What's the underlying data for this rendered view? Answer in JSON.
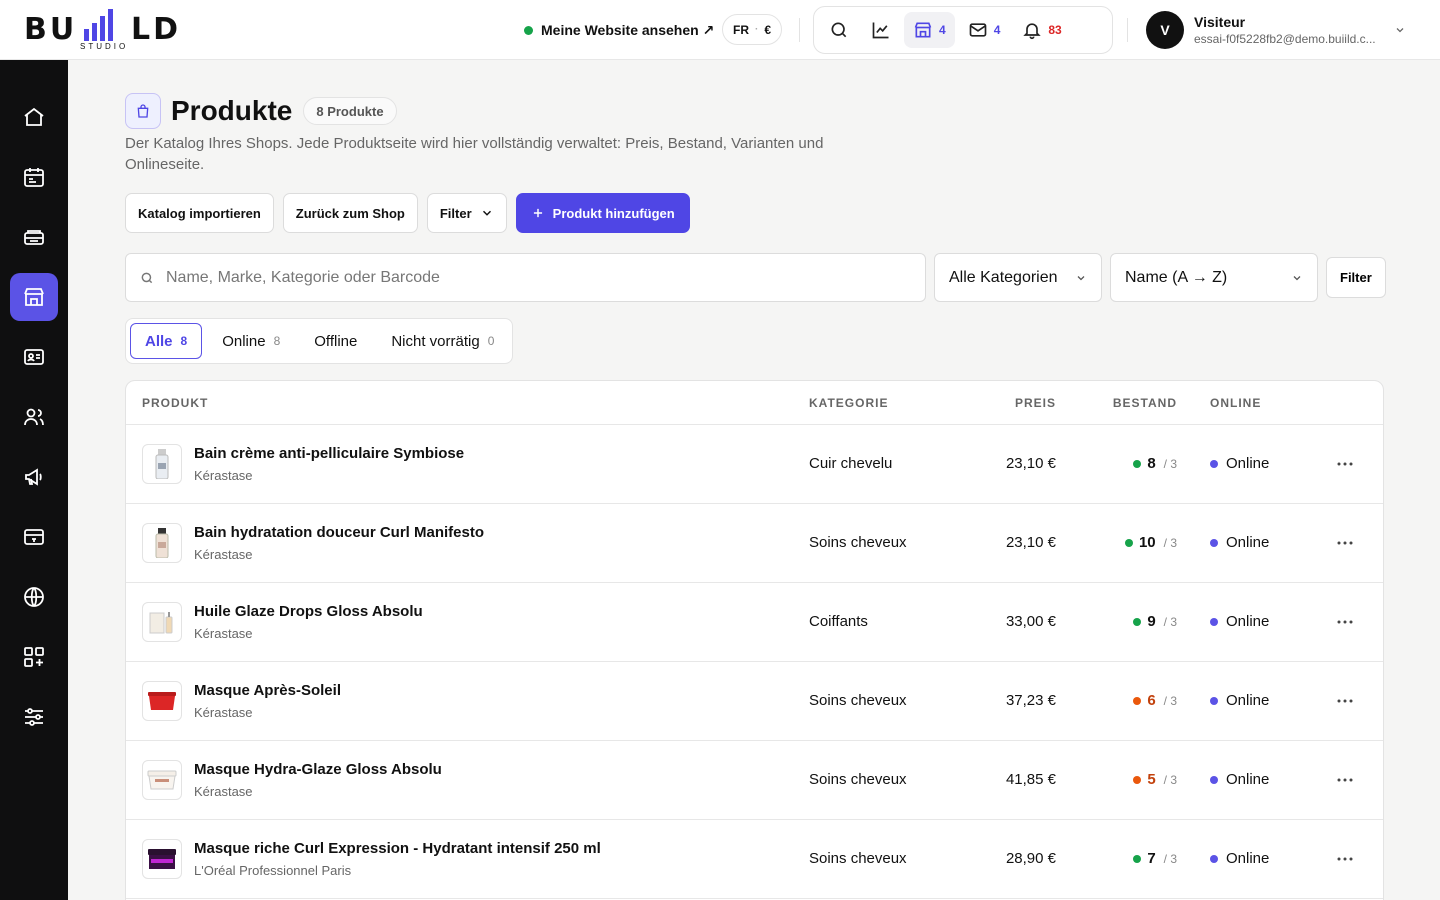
{
  "brand": {
    "logo_text": "BU LD",
    "logo_sub": "STUDIO"
  },
  "topbar": {
    "site_link": "Meine Website ansehen ↗",
    "lang": "FR",
    "lang_sep": "·",
    "currency": "€",
    "icon_buttons": [
      {
        "icon": "search-icon"
      },
      {
        "icon": "chart-icon"
      },
      {
        "icon": "store-icon",
        "count": "4"
      },
      {
        "icon": "mail-icon",
        "count": "4"
      },
      {
        "icon": "bell-icon",
        "count": "83"
      }
    ],
    "user": {
      "initial": "V",
      "name": "Visiteur",
      "email": "essai-f0f5228fb2@demo.buiild.c..."
    }
  },
  "sidebar": {
    "items": [
      {
        "icon": "home-icon"
      },
      {
        "icon": "calendar-icon"
      },
      {
        "icon": "inbox-icon"
      },
      {
        "icon": "store-icon",
        "active": true
      },
      {
        "icon": "contact-card-icon"
      },
      {
        "icon": "users-icon"
      },
      {
        "icon": "megaphone-icon"
      },
      {
        "icon": "payment-card-icon"
      },
      {
        "icon": "globe-icon"
      },
      {
        "icon": "apps-icon"
      },
      {
        "icon": "sliders-icon"
      }
    ]
  },
  "page": {
    "title": "Produkte",
    "count_badge": "8 Produkte",
    "description": "Der Katalog Ihres Shops. Jede Produktseite wird hier vollständig verwaltet: Preis, Bestand, Varianten und Onlineseite.",
    "actions": {
      "import": "Katalog importieren",
      "back": "Zurück zum Shop",
      "filter": "Filter",
      "add": "Produkt hinzufügen"
    },
    "search_placeholder": "Name, Marke, Kategorie oder Barcode",
    "category_select": "Alle Kategorien",
    "sort_select": "Name (A → Z)",
    "filter2": "Filter"
  },
  "tabs": [
    {
      "label": "Alle",
      "count": "8",
      "active": true
    },
    {
      "label": "Online",
      "count": "8"
    },
    {
      "label": "Offline",
      "count": ""
    },
    {
      "label": "Nicht vorrätig",
      "count": "0"
    }
  ],
  "table": {
    "headers": {
      "product": "PRODUKT",
      "category": "KATEGORIE",
      "price": "PREIS",
      "stock": "BESTAND",
      "online": "ONLINE"
    },
    "rows": [
      {
        "name": "Bain crème anti-pelliculaire Symbiose",
        "brand": "Kérastase",
        "category": "Cuir chevelu",
        "price": "23,10 €",
        "stock": "8",
        "stock_max": "/ 3",
        "stock_color": "#16a34a",
        "status": "Online"
      },
      {
        "name": "Bain hydratation douceur Curl Manifesto",
        "brand": "Kérastase",
        "category": "Soins cheveux",
        "price": "23,10 €",
        "stock": "10",
        "stock_max": "/ 3",
        "stock_color": "#16a34a",
        "status": "Online"
      },
      {
        "name": "Huile Glaze Drops Gloss Absolu",
        "brand": "Kérastase",
        "category": "Coiffants",
        "price": "33,00 €",
        "stock": "9",
        "stock_max": "/ 3",
        "stock_color": "#16a34a",
        "status": "Online"
      },
      {
        "name": "Masque Après-Soleil",
        "brand": "Kérastase",
        "category": "Soins cheveux",
        "price": "37,23 €",
        "stock": "6",
        "stock_max": "/ 3",
        "stock_color": "#ea580c",
        "status": "Online"
      },
      {
        "name": "Masque Hydra-Glaze Gloss Absolu",
        "brand": "Kérastase",
        "category": "Soins cheveux",
        "price": "41,85 €",
        "stock": "5",
        "stock_max": "/ 3",
        "stock_color": "#ea580c",
        "status": "Online"
      },
      {
        "name": "Masque riche Curl Expression - Hydratant intensif 250 ml",
        "brand": "L'Oréal Professionnel Paris",
        "category": "Soins cheveux",
        "price": "28,90 €",
        "stock": "7",
        "stock_max": "/ 3",
        "stock_color": "#16a34a",
        "status": "Online"
      }
    ]
  },
  "colors": {
    "accent": "#4f46e5",
    "sidebar_bg": "#0f0f10",
    "in_stock": "#16a34a",
    "low_stock": "#ea580c",
    "notif": "#dc2626"
  }
}
